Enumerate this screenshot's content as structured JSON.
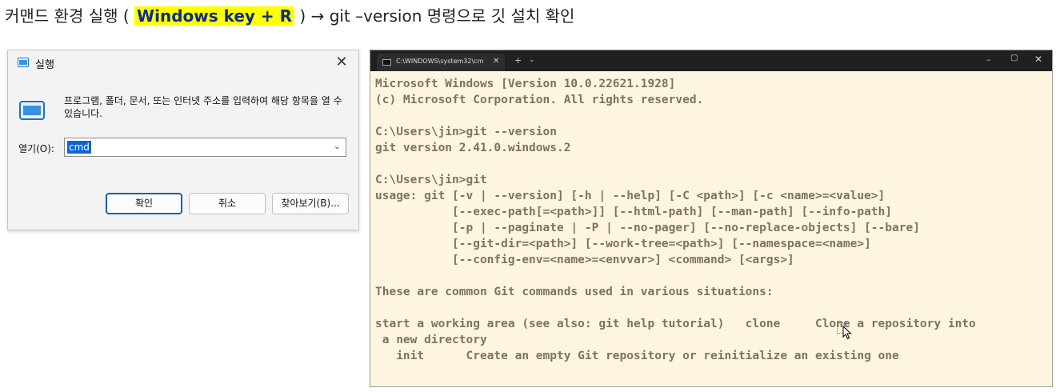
{
  "heading": {
    "prefix": "커맨드 환경 실행 ( ",
    "highlight": "Windows key + R",
    "suffix": " )  → git –version 명령으로 깃 설치 확인"
  },
  "run_dialog": {
    "title": "실행",
    "close": "✕",
    "description": "프로그램, 폴더, 문서, 또는 인터넷 주소를 입력하여 해당 항목을 열 수 있습니다.",
    "open_label": "열기(O):",
    "input_value": "cmd",
    "input_chevron": "⌄",
    "ok_label": "확인",
    "cancel_label": "취소",
    "browse_label": "찾아보기(B)..."
  },
  "terminal": {
    "tab_title": "C:\\WINDOWS\\system32\\cm",
    "tab_close": "✕",
    "new_tab": "+",
    "dropdown": "⌄",
    "minimize": "–",
    "maximize": "▢",
    "close": "✕",
    "lines": [
      "Microsoft Windows [Version 10.0.22621.1928]",
      "(c) Microsoft Corporation. All rights reserved.",
      "",
      "C:\\Users\\jin>git --version",
      "git version 2.41.0.windows.2",
      "",
      "C:\\Users\\jin>git",
      "usage: git [-v | --version] [-h | --help] [-C <path>] [-c <name>=<value>]",
      "           [--exec-path[=<path>]] [--html-path] [--man-path] [--info-path]",
      "           [-p | --paginate | -P | --no-pager] [--no-replace-objects] [--bare]",
      "           [--git-dir=<path>] [--work-tree=<path>] [--namespace=<name>]",
      "           [--config-env=<name>=<envvar>] <command> [<args>]",
      "",
      "These are common Git commands used in various situations:",
      "",
      "start a working area (see also: git help tutorial)   clone     Clone a repository into",
      " a new directory",
      "   init      Create an empty Git repository or reinitialize an existing one"
    ]
  },
  "icons": {
    "run_title_icon": "run-window-icon",
    "run_big_icon": "run-window-icon",
    "terminal_tab_icon": "cmd-icon",
    "mouse": "mouse-pointer-icon"
  },
  "colors": {
    "highlight": "#ffff00",
    "terminal_bg": "#fdf5dd",
    "terminal_text": "#7a7366",
    "titlebar": "#202020",
    "selection": "#0a64d8",
    "ok_border": "#1a5fb4"
  }
}
